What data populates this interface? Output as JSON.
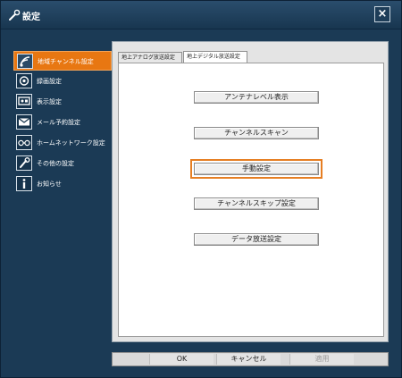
{
  "window": {
    "title": "設定"
  },
  "sidebar": {
    "items": [
      {
        "label": "地域チャンネル設定",
        "icon": "broadcast-icon",
        "active": true
      },
      {
        "label": "録画設定",
        "icon": "record-icon",
        "active": false
      },
      {
        "label": "表示設定",
        "icon": "display-icon",
        "active": false
      },
      {
        "label": "メール予約設定",
        "icon": "mail-icon",
        "active": false
      },
      {
        "label": "ホームネットワーク設定",
        "icon": "network-icon",
        "active": false
      },
      {
        "label": "その他の設定",
        "icon": "wrench-icon",
        "active": false
      },
      {
        "label": "お知らせ",
        "icon": "info-icon",
        "active": false
      }
    ]
  },
  "main": {
    "tabs": [
      {
        "label": "地上アナログ放送設定",
        "active": false
      },
      {
        "label": "地上デジタル放送設定",
        "active": true
      }
    ],
    "buttons": [
      {
        "label": "アンテナレベル表示"
      },
      {
        "label": "チャンネルスキャン"
      },
      {
        "label": "手動設定",
        "focused": true
      },
      {
        "label": "チャンネルスキップ設定"
      },
      {
        "label": "データ放送設定"
      }
    ]
  },
  "footer": {
    "ok": "OK",
    "cancel": "キャンセル",
    "apply": "適用"
  },
  "colors": {
    "window_bg": "#1b3a55",
    "active_item": "#e87712",
    "focus_outline": "#e67e22"
  }
}
